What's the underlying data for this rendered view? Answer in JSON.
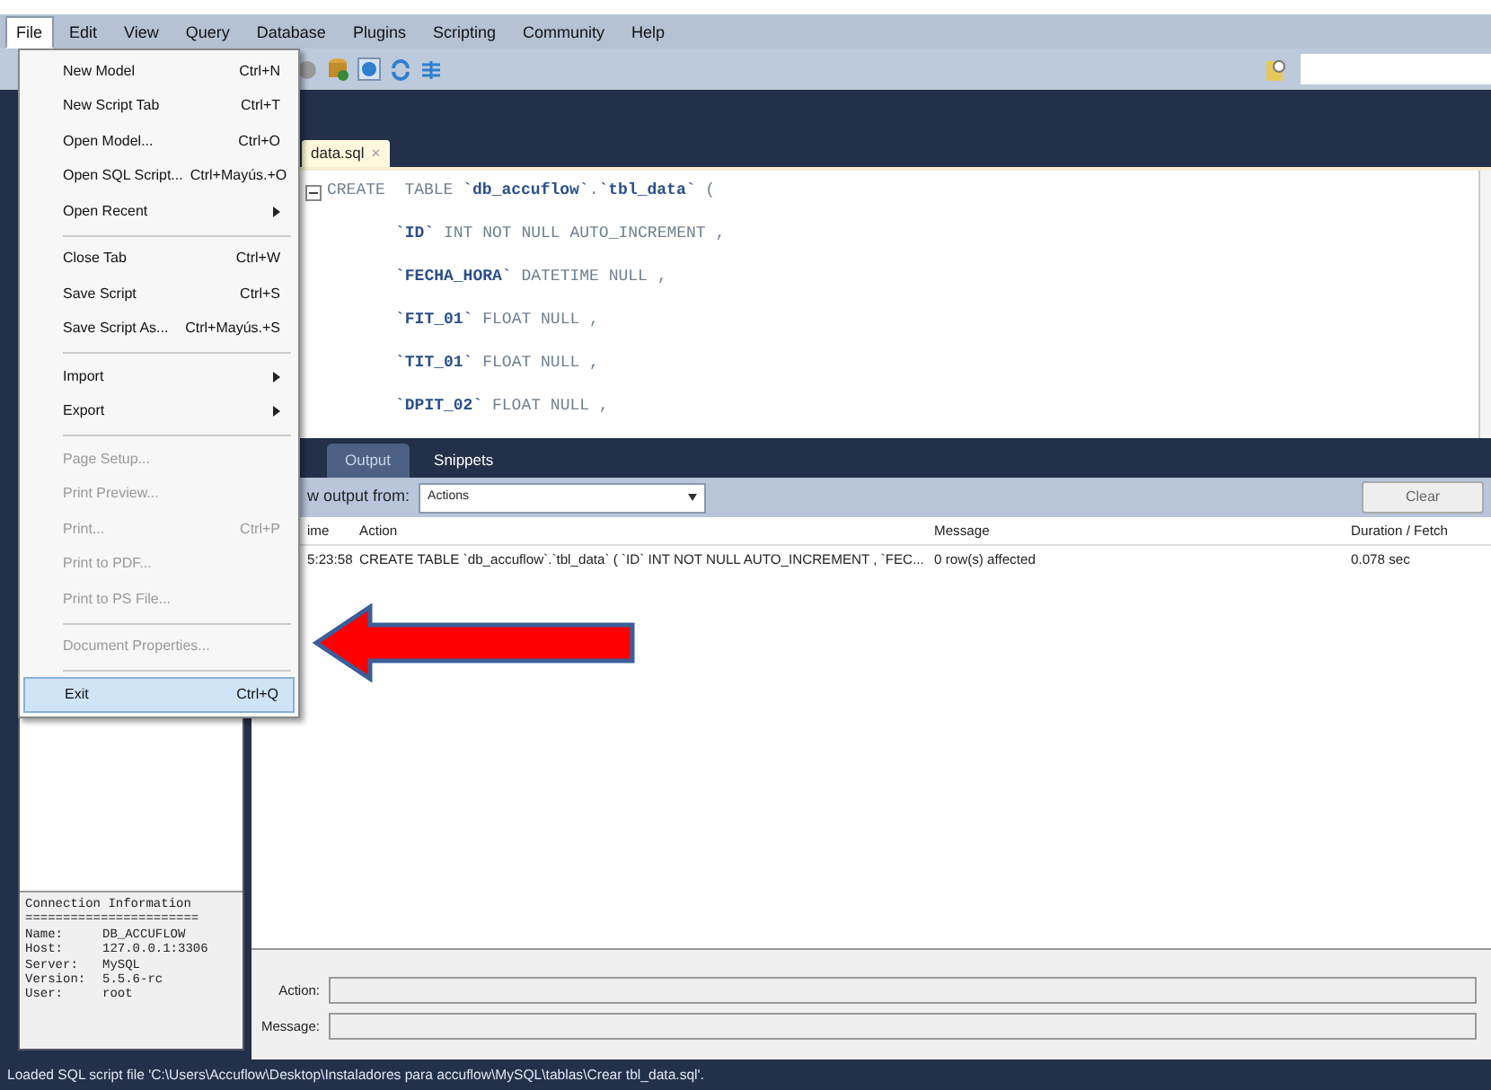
{
  "menubar": [
    {
      "label": "File",
      "selected": true
    },
    {
      "label": "Edit",
      "selected": false
    },
    {
      "label": "View",
      "selected": false
    },
    {
      "label": "Query",
      "selected": false
    },
    {
      "label": "Database",
      "selected": false
    },
    {
      "label": "Plugins",
      "selected": false
    },
    {
      "label": "Scripting",
      "selected": false
    },
    {
      "label": "Community",
      "selected": false
    },
    {
      "label": "Help",
      "selected": false
    }
  ],
  "file_menu": [
    {
      "kind": "item",
      "label": "New Model",
      "shortcut": "Ctrl+N",
      "disabled": false,
      "selected": false
    },
    {
      "kind": "item",
      "label": "New Script Tab",
      "shortcut": "Ctrl+T",
      "disabled": false,
      "selected": false
    },
    {
      "kind": "item",
      "label": "Open Model...",
      "shortcut": "Ctrl+O",
      "disabled": false,
      "selected": false
    },
    {
      "kind": "item",
      "label": "Open SQL Script...",
      "shortcut": "Ctrl+Mayús.+O",
      "disabled": false,
      "selected": false
    },
    {
      "kind": "submenu",
      "label": "Open Recent",
      "disabled": false,
      "selected": false
    },
    {
      "kind": "separator"
    },
    {
      "kind": "item",
      "label": "Close Tab",
      "shortcut": "Ctrl+W",
      "disabled": false,
      "selected": false
    },
    {
      "kind": "item",
      "label": "Save Script",
      "shortcut": "Ctrl+S",
      "disabled": false,
      "selected": false
    },
    {
      "kind": "item",
      "label": "Save Script As...",
      "shortcut": "Ctrl+Mayús.+S",
      "disabled": false,
      "selected": false
    },
    {
      "kind": "separator"
    },
    {
      "kind": "submenu",
      "label": "Import",
      "disabled": false,
      "selected": false
    },
    {
      "kind": "submenu",
      "label": "Export",
      "disabled": false,
      "selected": false
    },
    {
      "kind": "separator"
    },
    {
      "kind": "item",
      "label": "Page Setup...",
      "disabled": true,
      "selected": false
    },
    {
      "kind": "item",
      "label": "Print Preview...",
      "disabled": true,
      "selected": false
    },
    {
      "kind": "item",
      "label": "Print...",
      "shortcut": "Ctrl+P",
      "disabled": true,
      "selected": false
    },
    {
      "kind": "item",
      "label": "Print to PDF...",
      "disabled": true,
      "selected": false
    },
    {
      "kind": "item",
      "label": "Print to PS File...",
      "disabled": true,
      "selected": false
    },
    {
      "kind": "separator"
    },
    {
      "kind": "item",
      "label": "Document Properties...",
      "disabled": true,
      "selected": false
    },
    {
      "kind": "separator"
    },
    {
      "kind": "item",
      "label": "Exit",
      "shortcut": "Ctrl+Q",
      "disabled": false,
      "selected": true
    }
  ],
  "editor": {
    "tab": {
      "label": "data.sql",
      "close": "×"
    },
    "lines": [
      [
        {
          "kind": "keyword",
          "text": "CREATE  TABLE "
        },
        {
          "kind": "ident",
          "text": "`db_accuflow`"
        },
        {
          "kind": "keyword",
          "text": "."
        },
        {
          "kind": "ident",
          "text": "`tbl_data`"
        },
        {
          "kind": "keyword",
          "text": " ("
        }
      ],
      [
        {
          "kind": "ident",
          "text": "`ID`"
        },
        {
          "kind": "keyword",
          "text": " INT NOT NULL AUTO_INCREMENT ,"
        }
      ],
      [
        {
          "kind": "ident",
          "text": "`FECHA_HORA`"
        },
        {
          "kind": "keyword",
          "text": " DATETIME NULL ,"
        }
      ],
      [
        {
          "kind": "ident",
          "text": "`FIT_01`"
        },
        {
          "kind": "keyword",
          "text": " FLOAT NULL ,"
        }
      ],
      [
        {
          "kind": "ident",
          "text": "`TIT_01`"
        },
        {
          "kind": "keyword",
          "text": " FLOAT NULL ,"
        }
      ],
      [
        {
          "kind": "ident",
          "text": "`DPIT_02`"
        },
        {
          "kind": "keyword",
          "text": " FLOAT NULL ,"
        }
      ]
    ]
  },
  "output": {
    "tabs": [
      {
        "label": "Output",
        "selected": true
      },
      {
        "label": "Snippets",
        "selected": false
      }
    ],
    "show_from_label": "w output from:",
    "source": "Actions",
    "clear_button": "Clear",
    "columns": [
      "ime",
      "Action",
      "Message",
      "Duration / Fetch"
    ],
    "rows": [
      [
        "5:23:58",
        "CREATE  TABLE `db_accuflow`.`tbl_data` ( `ID` INT NOT NULL AUTO_INCREMENT ,  `FEC...",
        "0 row(s) affected",
        "0.078 sec"
      ]
    ]
  },
  "connection_info": {
    "title": "Connection Information",
    "rule": "=======================",
    "fields": [
      {
        "label": "Name:",
        "value": "DB_ACCUFLOW"
      },
      {
        "label": "Host:",
        "value": "127.0.0.1:3306"
      },
      {
        "label": "Server:",
        "value": "MySQL"
      },
      {
        "label": "Version:",
        "value": "5.5.6-rc"
      },
      {
        "label": "User:",
        "value": "root"
      }
    ]
  },
  "details": [
    {
      "label": "Action:"
    },
    {
      "label": "Message:"
    }
  ],
  "status_bar": "Loaded SQL script file 'C:\\Users\\Accuflow\\Desktop\\Instaladores para accuflow\\MySQL\\tablas\\Crear tbl_data.sql'."
}
